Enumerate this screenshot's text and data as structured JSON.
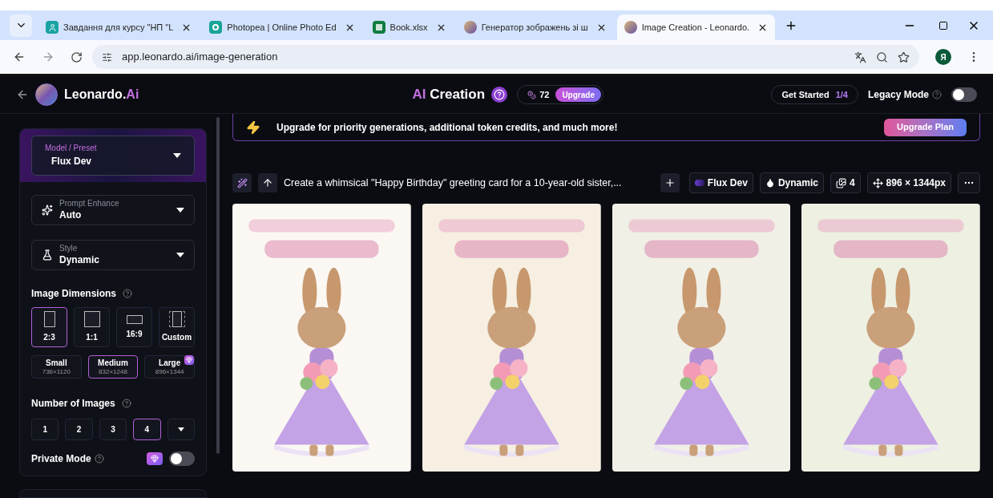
{
  "browser": {
    "tabs": [
      {
        "title": "Завдання для курсу \"НП \"L",
        "selected": false
      },
      {
        "title": "Photopea | Online Photo Ed",
        "selected": false
      },
      {
        "title": "Book.xlsx",
        "selected": false
      },
      {
        "title": "Генератор зображень зі ш",
        "selected": false
      },
      {
        "title": "Image Creation - Leonardo.",
        "selected": true
      }
    ],
    "address": "app.leonardo.ai/image-generation",
    "profile": "Я"
  },
  "header": {
    "brand": "Leonardo.",
    "brand_accent": "Ai",
    "title_accent": "AI",
    "title": "Creation",
    "credits": "72",
    "upgrade": "Upgrade",
    "get_started": "Get Started",
    "progress": "1/4",
    "legacy_mode": {
      "label": "Legacy Mode",
      "on": false
    }
  },
  "banner": {
    "text": "Upgrade for priority generations, additional token credits, and much more!",
    "button": "Upgrade Plan"
  },
  "sidebar": {
    "model": {
      "label": "Model / Preset",
      "value": "Flux Dev"
    },
    "prompt_enhance": {
      "label": "Prompt Enhance",
      "value": "Auto"
    },
    "style": {
      "label": "Style",
      "value": "Dynamic"
    },
    "dimensions_label": "Image Dimensions",
    "aspect_ratios": [
      {
        "label": "2:3",
        "kind": "portrait",
        "selected": true
      },
      {
        "label": "1:1",
        "kind": "square",
        "selected": false
      },
      {
        "label": "16:9",
        "kind": "landscape",
        "selected": false
      },
      {
        "label": "Custom",
        "kind": "custom",
        "selected": false
      }
    ],
    "sizes": [
      {
        "label": "Small",
        "resolution": "736×1120",
        "selected": false,
        "premium": false
      },
      {
        "label": "Medium",
        "resolution": "832×1248",
        "selected": true,
        "premium": false
      },
      {
        "label": "Large",
        "resolution": "896×1344",
        "selected": false,
        "premium": true
      }
    ],
    "count_label": "Number of Images",
    "counts": [
      {
        "label": "1",
        "selected": false
      },
      {
        "label": "2",
        "selected": false
      },
      {
        "label": "3",
        "selected": false
      },
      {
        "label": "4",
        "selected": true
      }
    ],
    "private_mode": {
      "label": "Private Mode",
      "on": false
    }
  },
  "generation": {
    "prompt": "Create a whimsical \"Happy Birthday\" greeting card for a 10-year-old sister,...",
    "chips": [
      {
        "kind": "model",
        "label": "Flux Dev"
      },
      {
        "kind": "style",
        "label": "Dynamic"
      },
      {
        "kind": "count",
        "label": "4"
      },
      {
        "kind": "size",
        "label": "896 × 1344px"
      }
    ]
  }
}
